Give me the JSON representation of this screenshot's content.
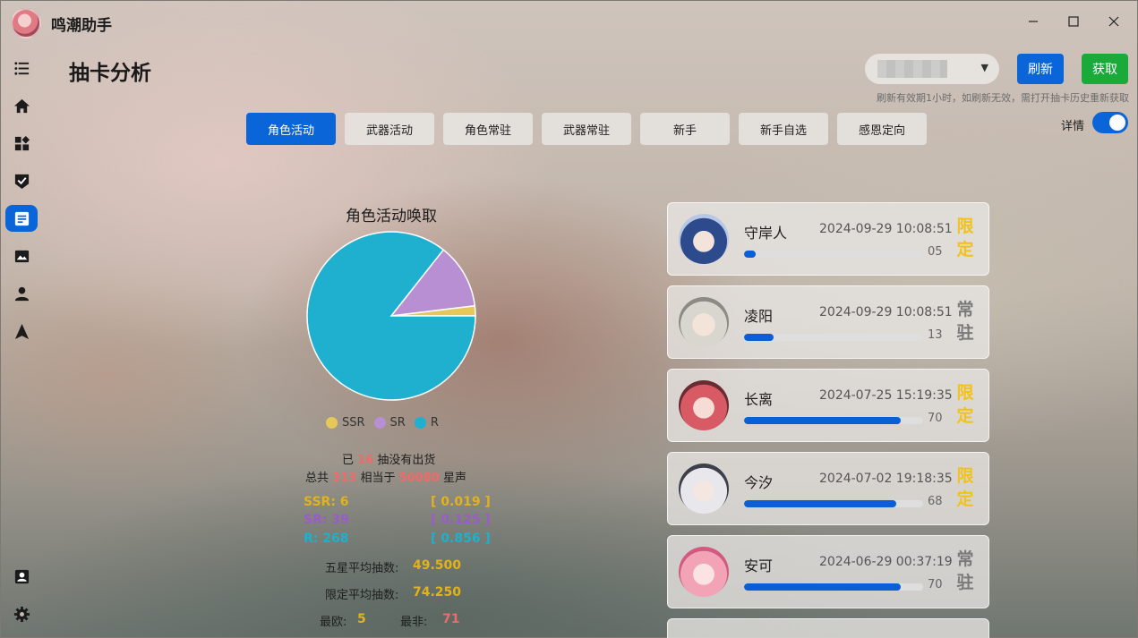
{
  "app": {
    "title": "鸣潮助手",
    "page_title": "抽卡分析"
  },
  "sidebar": {
    "items": [
      {
        "icon": "list-icon"
      },
      {
        "icon": "home-icon"
      },
      {
        "icon": "dashboard-icon"
      },
      {
        "icon": "shield-check-icon"
      },
      {
        "icon": "document-icon",
        "active": true
      },
      {
        "icon": "image-icon"
      },
      {
        "icon": "user-icon"
      },
      {
        "icon": "navigation-arrow-icon"
      },
      {
        "icon": "contact-card-icon"
      },
      {
        "icon": "gear-icon"
      }
    ]
  },
  "toolbar": {
    "refresh_label": "刷新",
    "fetch_label": "获取",
    "hint": "刷新有效期1小时，如刷新无效，需打开抽卡历史重新获取",
    "detail_label": "详情",
    "detail_enabled": true
  },
  "tabs": [
    {
      "label": "角色活动",
      "active": true
    },
    {
      "label": "武器活动"
    },
    {
      "label": "角色常驻"
    },
    {
      "label": "武器常驻"
    },
    {
      "label": "新手"
    },
    {
      "label": "新手自选"
    },
    {
      "label": "感恩定向"
    }
  ],
  "chart_data": {
    "type": "pie",
    "title": "角色活动唤取",
    "categories": [
      "SSR",
      "SR",
      "R"
    ],
    "values": [
      6,
      39,
      268
    ],
    "colors": [
      "#e6c85a",
      "#b98fd3",
      "#1fb0d0"
    ],
    "legend_position": "bottom"
  },
  "stats": {
    "pity_prefix": "已",
    "pity_value": "16",
    "pity_suffix": "抽没有出货",
    "total_prefix": "总共",
    "total_value": "313",
    "total_mid": "相当于",
    "astrite_value": "50080",
    "astrite_suffix": "星声",
    "ssr_label": "SSR: 6",
    "ssr_rate": "[ 0.019 ]",
    "sr_label": "SR: 39",
    "sr_rate": "[ 0.125 ]",
    "r_label": "R: 268",
    "r_rate": "[ 0.856 ]",
    "avg_five_label": "五星平均抽数:",
    "avg_five_value": "49.500",
    "avg_limited_label": "限定平均抽数:",
    "avg_limited_value": "74.250",
    "best_label": "最欧:",
    "best_value": "5",
    "worst_label": "最非:",
    "worst_value": "71"
  },
  "records": [
    {
      "name": "守岸人",
      "time": "2024-09-29 10:08:51",
      "count": "05",
      "pulls": 5,
      "tag": "限定",
      "limited": true
    },
    {
      "name": "凌阳",
      "time": "2024-09-29 10:08:51",
      "count": "13",
      "pulls": 13,
      "tag": "常驻",
      "limited": false
    },
    {
      "name": "长离",
      "time": "2024-07-25 15:19:35",
      "count": "70",
      "pulls": 70,
      "tag": "限定",
      "limited": true
    },
    {
      "name": "今汐",
      "time": "2024-07-02 19:18:35",
      "count": "68",
      "pulls": 68,
      "tag": "限定",
      "limited": true
    },
    {
      "name": "安可",
      "time": "2024-06-29 00:37:19",
      "count": "70",
      "pulls": 70,
      "tag": "常驻",
      "limited": false
    }
  ]
}
